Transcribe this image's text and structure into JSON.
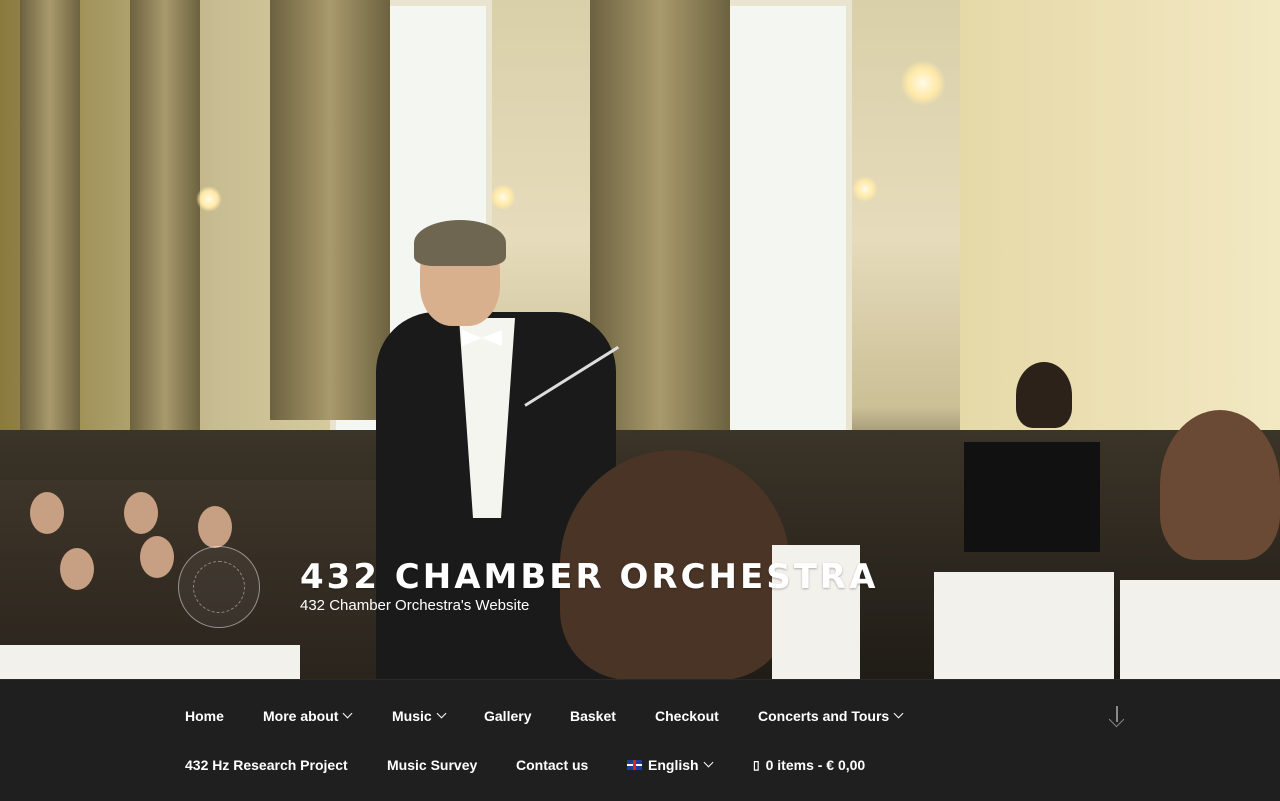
{
  "branding": {
    "title": "432 CHAMBER ORCHESTRA",
    "description": "432 Chamber Orchestra's Website"
  },
  "nav": {
    "row1": [
      {
        "label": "Home",
        "dropdown": false
      },
      {
        "label": "More about",
        "dropdown": true
      },
      {
        "label": "Music",
        "dropdown": true
      },
      {
        "label": "Gallery",
        "dropdown": false
      },
      {
        "label": "Basket",
        "dropdown": false
      },
      {
        "label": "Checkout",
        "dropdown": false
      },
      {
        "label": "Concerts and Tours",
        "dropdown": true
      }
    ],
    "row2": [
      {
        "label": "432 Hz Research Project",
        "dropdown": false
      },
      {
        "label": "Music Survey",
        "dropdown": false
      },
      {
        "label": "Contact us",
        "dropdown": false
      }
    ],
    "language": {
      "label": "English",
      "flag_icon": "uk-flag-icon"
    },
    "cart": {
      "label": "0 items - € 0,00",
      "icon": "cart-icon"
    },
    "scroll_icon": "arrow-down-icon"
  },
  "colors": {
    "nav_bg": "#1f1f1f",
    "nav_text": "#ffffff",
    "title_text": "#ffffff"
  }
}
